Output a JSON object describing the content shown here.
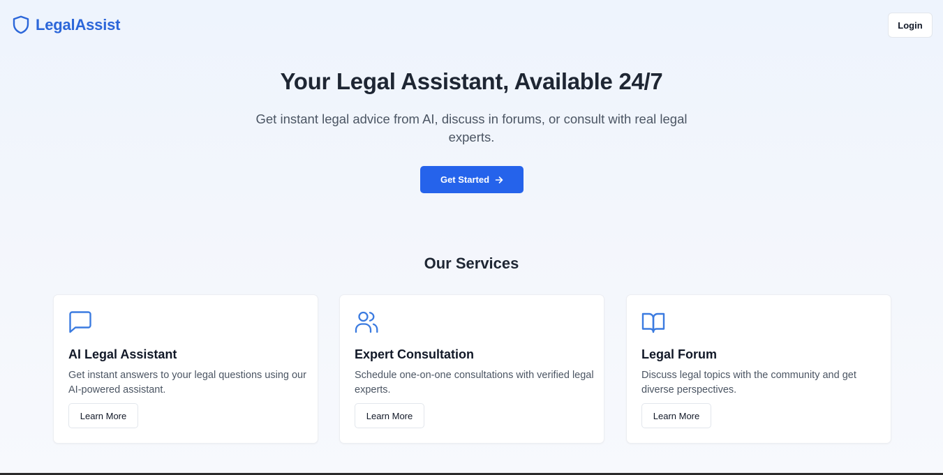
{
  "header": {
    "brand": "LegalAssist",
    "login_label": "Login"
  },
  "hero": {
    "title": "Your Legal Assistant, Available 24/7",
    "subtitle": "Get instant legal advice from AI, discuss in forums, or consult with real legal experts.",
    "cta_label": "Get Started"
  },
  "services": {
    "title": "Our Services",
    "cards": [
      {
        "icon": "message-square-icon",
        "title": "AI Legal Assistant",
        "description": "Get instant answers to your legal questions using our AI-powered assistant.",
        "button_label": "Learn More"
      },
      {
        "icon": "users-icon",
        "title": "Expert Consultation",
        "description": "Schedule one-on-one consultations with verified legal experts.",
        "button_label": "Learn More"
      },
      {
        "icon": "book-open-icon",
        "title": "Legal Forum",
        "description": "Discuss legal topics with the community and get diverse perspectives.",
        "button_label": "Learn More"
      }
    ]
  },
  "colors": {
    "brand": "#2b66d9",
    "primary_button": "#2563eb",
    "icon": "#3b7be0"
  }
}
